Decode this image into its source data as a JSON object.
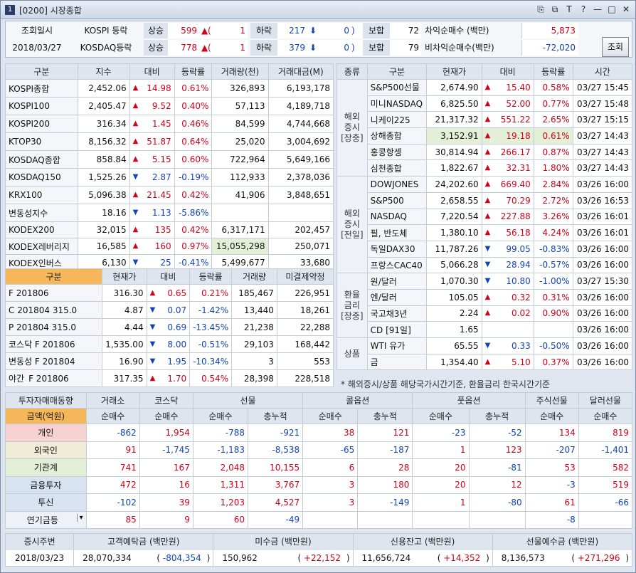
{
  "window": {
    "number": "1",
    "title": "[0200] 시장종합",
    "controls": [
      "⎘",
      "⧉",
      "T",
      "?",
      "—",
      "□",
      "✕"
    ]
  },
  "header": {
    "date_label": "조회일시",
    "date": "2018/03/27",
    "rows": [
      {
        "market": "KOSPI 등락",
        "up_label": "상승",
        "up": "599",
        "up_arrow": "▲",
        "up_limit": "1",
        "down_label": "하락",
        "down": "217",
        "down_limit": "0",
        "flat_label": "보합",
        "flat": "72"
      },
      {
        "market": "KOSDAQ등락",
        "up_label": "상승",
        "up": "778",
        "up_arrow": "▲",
        "up_limit": "1",
        "down_label": "하락",
        "down": "379",
        "down_limit": "0",
        "flat_label": "보합",
        "flat": "79"
      }
    ],
    "arb": [
      {
        "label": "차익순매수 (백만)",
        "value": "5,873"
      },
      {
        "label": "비차익순매수(백만)",
        "value": "-72,020"
      }
    ],
    "search_btn": "조회"
  },
  "index_table": {
    "headers": [
      "구분",
      "지수",
      "대비",
      "등락률",
      "거래량(천)",
      "거래대금(M)"
    ],
    "rows": [
      {
        "name": "KOSPI종합",
        "value": "2,452.06",
        "dir": "up",
        "chg": "14.98",
        "rate": "0.61%",
        "vol": "326,893",
        "amt": "6,193,178"
      },
      {
        "name": "KOSPI100",
        "value": "2,405.47",
        "dir": "up",
        "chg": "9.52",
        "rate": "0.40%",
        "vol": "57,113",
        "amt": "4,189,718"
      },
      {
        "name": "KOSPI200",
        "value": "316.34",
        "dir": "up",
        "chg": "1.45",
        "rate": "0.46%",
        "vol": "84,599",
        "amt": "4,744,668"
      },
      {
        "name": "KTOP30",
        "value": "8,156.32",
        "dir": "up",
        "chg": "51.87",
        "rate": "0.64%",
        "vol": "25,020",
        "amt": "3,004,692"
      },
      {
        "name": "KOSDAQ종합",
        "value": "858.84",
        "dir": "up",
        "chg": "5.15",
        "rate": "0.60%",
        "vol": "722,964",
        "amt": "5,649,166"
      },
      {
        "name": "KOSDAQ150",
        "value": "1,525.26",
        "dir": "dn",
        "chg": "2.87",
        "rate": "-0.19%",
        "vol": "112,933",
        "amt": "2,378,036"
      },
      {
        "name": "KRX100",
        "value": "5,096.38",
        "dir": "up",
        "chg": "21.45",
        "rate": "0.42%",
        "vol": "41,906",
        "amt": "3,848,651"
      },
      {
        "name": "변동성지수",
        "value": "18.16",
        "dir": "dn",
        "chg": "1.13",
        "rate": "-5.86%",
        "vol": "",
        "amt": ""
      },
      {
        "name": "KODEX200",
        "value": "32,015",
        "dir": "up",
        "chg": "135",
        "rate": "0.42%",
        "vol": "6,317,171",
        "amt": "202,457"
      },
      {
        "name": "KODEX레버리지",
        "value": "16,585",
        "dir": "up",
        "chg": "160",
        "rate": "0.97%",
        "vol": "15,055,298",
        "amt": "250,071"
      },
      {
        "name": "KODEX인버스",
        "value": "6,130",
        "dir": "dn",
        "chg": "25",
        "rate": "-0.41%",
        "vol": "5,499,677",
        "amt": "33,680"
      }
    ]
  },
  "futures_table": {
    "headers": [
      "구분",
      "현재가",
      "대비",
      "등락률",
      "거래량",
      "미결제약정"
    ],
    "rows": [
      {
        "name": "F 201806",
        "value": "316.30",
        "dir": "up",
        "chg": "0.65",
        "rate": "0.21%",
        "vol": "185,467",
        "oi": "226,951"
      },
      {
        "name": "C 201804 315.0",
        "value": "4.87",
        "dir": "dn",
        "chg": "0.07",
        "rate": "-1.42%",
        "vol": "13,440",
        "oi": "18,261"
      },
      {
        "name": "P 201804 315.0",
        "value": "4.44",
        "dir": "dn",
        "chg": "0.69",
        "rate": "-13.45%",
        "vol": "21,238",
        "oi": "22,288"
      },
      {
        "name": "코스닥 F 201806",
        "value": "1,535.00",
        "dir": "dn",
        "chg": "8.00",
        "rate": "-0.51%",
        "vol": "29,103",
        "oi": "168,442"
      },
      {
        "name": "변동성 F 201804",
        "value": "16.90",
        "dir": "dn",
        "chg": "1.95",
        "rate": "-10.34%",
        "vol": "3",
        "oi": "553"
      }
    ],
    "night": {
      "tag": "야간",
      "name": "F 201806",
      "value": "317.35",
      "dir": "up",
      "chg": "1.70",
      "rate": "0.54%",
      "vol": "28,398",
      "oi": "228,518"
    }
  },
  "world_table": {
    "headers": [
      "종류",
      "구분",
      "현재가",
      "대비",
      "등락률",
      "시간"
    ],
    "groups": [
      {
        "label": "해외\n증시\n[장중]",
        "rows": [
          {
            "name": "S&P500선물",
            "value": "2,674.90",
            "dir": "up",
            "chg": "15.40",
            "rate": "0.58%",
            "time": "03/27 15:45"
          },
          {
            "name": "미니NASDAQ",
            "value": "6,825.50",
            "dir": "up",
            "chg": "52.00",
            "rate": "0.77%",
            "time": "03/27 15:48"
          },
          {
            "name": "니케이225",
            "value": "21,317.32",
            "dir": "up",
            "chg": "551.22",
            "rate": "2.65%",
            "time": "03/27 15:15"
          },
          {
            "name": "상해종합",
            "value": "3,152.91",
            "dir": "up",
            "chg": "19.18",
            "rate": "0.61%",
            "time": "03/27 14:43"
          },
          {
            "name": "홍콩항셍",
            "value": "30,814.94",
            "dir": "up",
            "chg": "266.17",
            "rate": "0.87%",
            "time": "03/27 14:43"
          },
          {
            "name": "심천종합",
            "value": "1,822.67",
            "dir": "up",
            "chg": "32.31",
            "rate": "1.80%",
            "time": "03/27 14:43"
          }
        ]
      },
      {
        "label": "해외\n증시\n[전일]",
        "rows": [
          {
            "name": "DOWJONES",
            "value": "24,202.60",
            "dir": "up",
            "chg": "669.40",
            "rate": "2.84%",
            "time": "03/26 16:00"
          },
          {
            "name": "S&P500",
            "value": "2,658.55",
            "dir": "up",
            "chg": "70.29",
            "rate": "2.72%",
            "time": "03/26 16:53"
          },
          {
            "name": "NASDAQ",
            "value": "7,220.54",
            "dir": "up",
            "chg": "227.88",
            "rate": "3.26%",
            "time": "03/26 16:01"
          },
          {
            "name": "필, 반도체",
            "value": "1,380.10",
            "dir": "up",
            "chg": "56.18",
            "rate": "4.24%",
            "time": "03/26 16:01"
          },
          {
            "name": "독일DAX30",
            "value": "11,787.26",
            "dir": "dn",
            "chg": "99.05",
            "rate": "-0.83%",
            "time": "03/26 16:00"
          },
          {
            "name": "프랑스CAC40",
            "value": "5,066.28",
            "dir": "dn",
            "chg": "28.94",
            "rate": "-0.57%",
            "time": "03/26 16:00"
          }
        ]
      },
      {
        "label": "환율\n금리\n[장중]",
        "rows": [
          {
            "name": "원/달러",
            "value": "1,070.30",
            "dir": "dn",
            "chg": "10.80",
            "rate": "-1.00%",
            "time": "03/27 15:30"
          },
          {
            "name": "엔/달러",
            "value": "105.05",
            "dir": "up",
            "chg": "0.32",
            "rate": "0.31%",
            "time": "03/26 16:00"
          },
          {
            "name": "국고채3년",
            "value": "2.24",
            "dir": "up",
            "chg": "0.02",
            "rate": "0.90%",
            "time": "03/26 16:00"
          },
          {
            "name": "CD [91일]",
            "value": "1.65",
            "dir": "",
            "chg": "",
            "rate": "",
            "time": "03/26 16:00"
          }
        ]
      },
      {
        "label": "상품",
        "rows": [
          {
            "name": "WTI 유가",
            "value": "65.55",
            "dir": "dn",
            "chg": "0.33",
            "rate": "-0.50%",
            "time": "03/26 16:00"
          },
          {
            "name": "금",
            "value": "1,354.40",
            "dir": "up",
            "chg": "5.10",
            "rate": "0.37%",
            "time": "03/26 16:00"
          }
        ]
      }
    ]
  },
  "note": "* 해외증시/상품 해당국가시간기준, 환율금리 한국시간기준",
  "investor_table": {
    "corner": "투자자매매동향",
    "unit": "금액(억원)",
    "groups": [
      "거래소",
      "코스닥",
      "선물",
      "콜옵션",
      "풋옵션",
      "주식선물",
      "달러선물"
    ],
    "subs": [
      "순매수",
      "순매수",
      "순매수",
      "총누적",
      "순매수",
      "총누적",
      "순매수",
      "총누적",
      "순매수",
      "순매수"
    ],
    "rows": [
      {
        "name": "개인",
        "vals": [
          "-862",
          "1,954",
          "-788",
          "-921",
          "38",
          "121",
          "-23",
          "-52",
          "134",
          "819"
        ]
      },
      {
        "name": "외국인",
        "vals": [
          "91",
          "-1,745",
          "-1,183",
          "-8,538",
          "-65",
          "-187",
          "1",
          "123",
          "-207",
          "-1,401"
        ]
      },
      {
        "name": "기관계",
        "vals": [
          "741",
          "167",
          "2,048",
          "10,155",
          "6",
          "28",
          "20",
          "-81",
          "53",
          "582"
        ]
      },
      {
        "name": "금융투자",
        "vals": [
          "472",
          "16",
          "1,311",
          "3,767",
          "3",
          "180",
          "20",
          "12",
          "-3",
          "519"
        ]
      },
      {
        "name": "투신",
        "vals": [
          "-102",
          "39",
          "1,203",
          "4,527",
          "3",
          "-149",
          "1",
          "-80",
          "61",
          "-66"
        ]
      },
      {
        "name": "연기금등",
        "vals": [
          "85",
          "9",
          "60",
          "-49",
          "",
          "",
          "",
          "",
          "-8",
          ""
        ]
      }
    ]
  },
  "deposits": {
    "headers": [
      "증시주변",
      "고객예탁금 (백만원)",
      "미수금 (백만원)",
      "신용잔고 (백만원)",
      "선물예수금 (백만원)"
    ],
    "date": "2018/03/23",
    "items": [
      {
        "value": "28,070,334",
        "chg": "-804,354"
      },
      {
        "value": "150,962",
        "chg": "+22,152"
      },
      {
        "value": "11,656,724",
        "chg": "+14,352"
      },
      {
        "value": "8,136,573",
        "chg": "+271,296"
      }
    ]
  },
  "colors": {
    "up": "#d0021b",
    "down": "#1443b4",
    "header_bg": "#dfe5ee",
    "orange": "#f5b75a",
    "individual": "#f6d2d2",
    "foreign": "#f1ecd5",
    "institution": "#e2efd6",
    "finance": "#d8e3f1"
  }
}
